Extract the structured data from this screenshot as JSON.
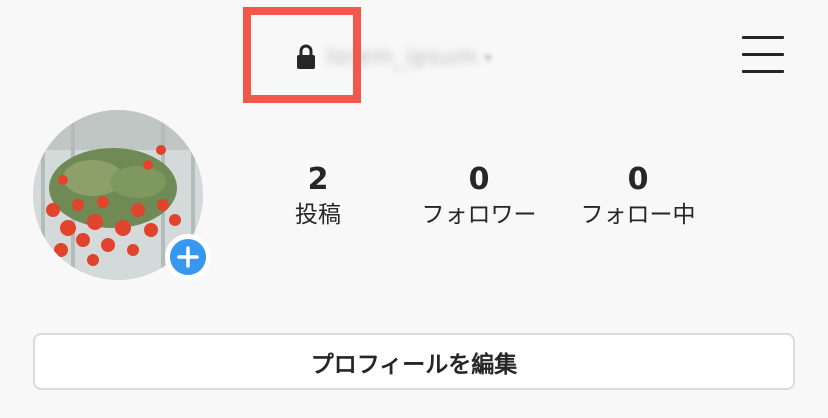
{
  "header": {
    "username": "lorem_ipsum",
    "lock_icon": "lock-icon",
    "chevron_icon": "chevron-down-icon",
    "menu_icon": "hamburger-menu-icon",
    "highlight_color": "#f0584b"
  },
  "profile": {
    "avatar": "hanging-flower-basket-photo",
    "add_icon": "plus-icon",
    "accent_color": "#3897f0"
  },
  "stats": {
    "posts": {
      "value": "2",
      "label": "投稿"
    },
    "followers": {
      "value": "0",
      "label": "フォロワー"
    },
    "following": {
      "value": "0",
      "label": "フォロー中"
    }
  },
  "actions": {
    "edit_profile_label": "プロフィールを編集"
  }
}
